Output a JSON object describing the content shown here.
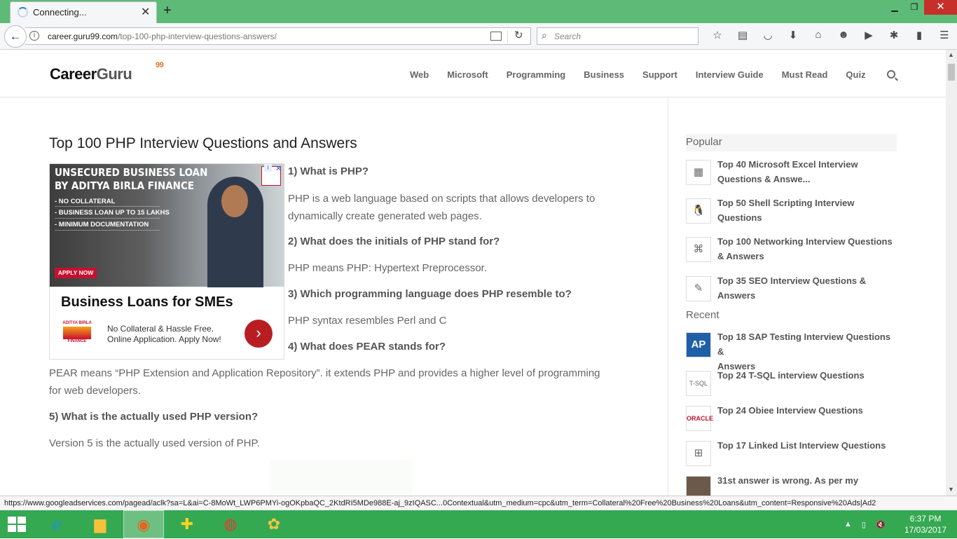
{
  "browser": {
    "tab_title": "Connecting...",
    "url_domain": "career.guru99.com",
    "url_path": "/top-100-php-interview-questions-answers/",
    "search_placeholder": "Search"
  },
  "site": {
    "logo_text": "Career",
    "logo_text2": "Guru",
    "logo_sup": "99",
    "nav": [
      "Web",
      "Microsoft",
      "Programming",
      "Business",
      "Support",
      "Interview Guide",
      "Must Read",
      "Quiz"
    ]
  },
  "article": {
    "title": "Top 100 PHP Interview Questions and Answers",
    "q1": "1) What is PHP?",
    "a1_line1": "PHP is a web language based on scripts that allows developers to",
    "a1_line2": "dynamically create generated web pages.",
    "q2": "2) What does the initials of PHP stand for?",
    "a2": "PHP means PHP: Hypertext Preprocessor.",
    "q3": "3) Which programming language does PHP resemble to?",
    "a3": "PHP syntax resembles Perl and C",
    "q4": "4) What does PEAR stands for?",
    "a4_line1": "PEAR means “PHP Extension and Application Repository”. it extends PHP and provides a higher level of programming",
    "a4_line2": "for web developers.",
    "q5": "5) What is the actually used PHP version?",
    "a5": "Version 5 is the actually used version of PHP."
  },
  "ad": {
    "headline1": "UNSECURED BUSINESS LOAN",
    "headline2": "BY ADITYA BIRLA FINANCE",
    "bullet1": "- NO COLLATERAL",
    "bullet2": "- BUSINESS LOAN UP TO 15 LAKHS",
    "bullet3": "- MINIMUM DOCUMENTATION",
    "apply": "APPLY NOW",
    "title": "Business Loans for SMEs",
    "logo_text": "ADITYA BIRLA",
    "logo_sub": "FINANCE",
    "text1": "No Collateral & Hassle Free.",
    "text2": "Online Application. Apply Now!"
  },
  "sidebar": {
    "popular_header": "Popular",
    "popular": [
      "Top 40 Microsoft Excel Interview",
      "Questions & Answe...",
      "Top 50 Shell Scripting Interview",
      "Questions",
      "Top 100 Networking Interview Questions",
      "& Answers",
      "Top 35 SEO Interview Questions &",
      "Answers"
    ],
    "recent_header": "Recent",
    "recent": [
      "Top 18 SAP Testing Interview Questions &",
      "Answers",
      "Top 24 T-SQL interview Questions",
      "Top 24 Obiee Interview Questions",
      "Top 17 Linked List Interview Questions",
      "31st answer is wrong. As per my"
    ]
  },
  "status_url": "https://www.googleadservices.com/pagead/aclk?sa=L&ai=C-8MoWt_LWP6PMYi-ogOKpbaQC_2KtdRI5MDe988E-aj_9zIQASC...0Contextual&utm_medium=cpc&utm_term=Collateral%20Free%20Business%20Loans&utm_content=Responsive%20Ads|Ad2",
  "clock": {
    "time": "6:37 PM",
    "date": "17/03/2017"
  },
  "colors": {
    "tabbar": "#5dbb77",
    "taskbar": "#35a852",
    "accent": "#e5731f"
  }
}
